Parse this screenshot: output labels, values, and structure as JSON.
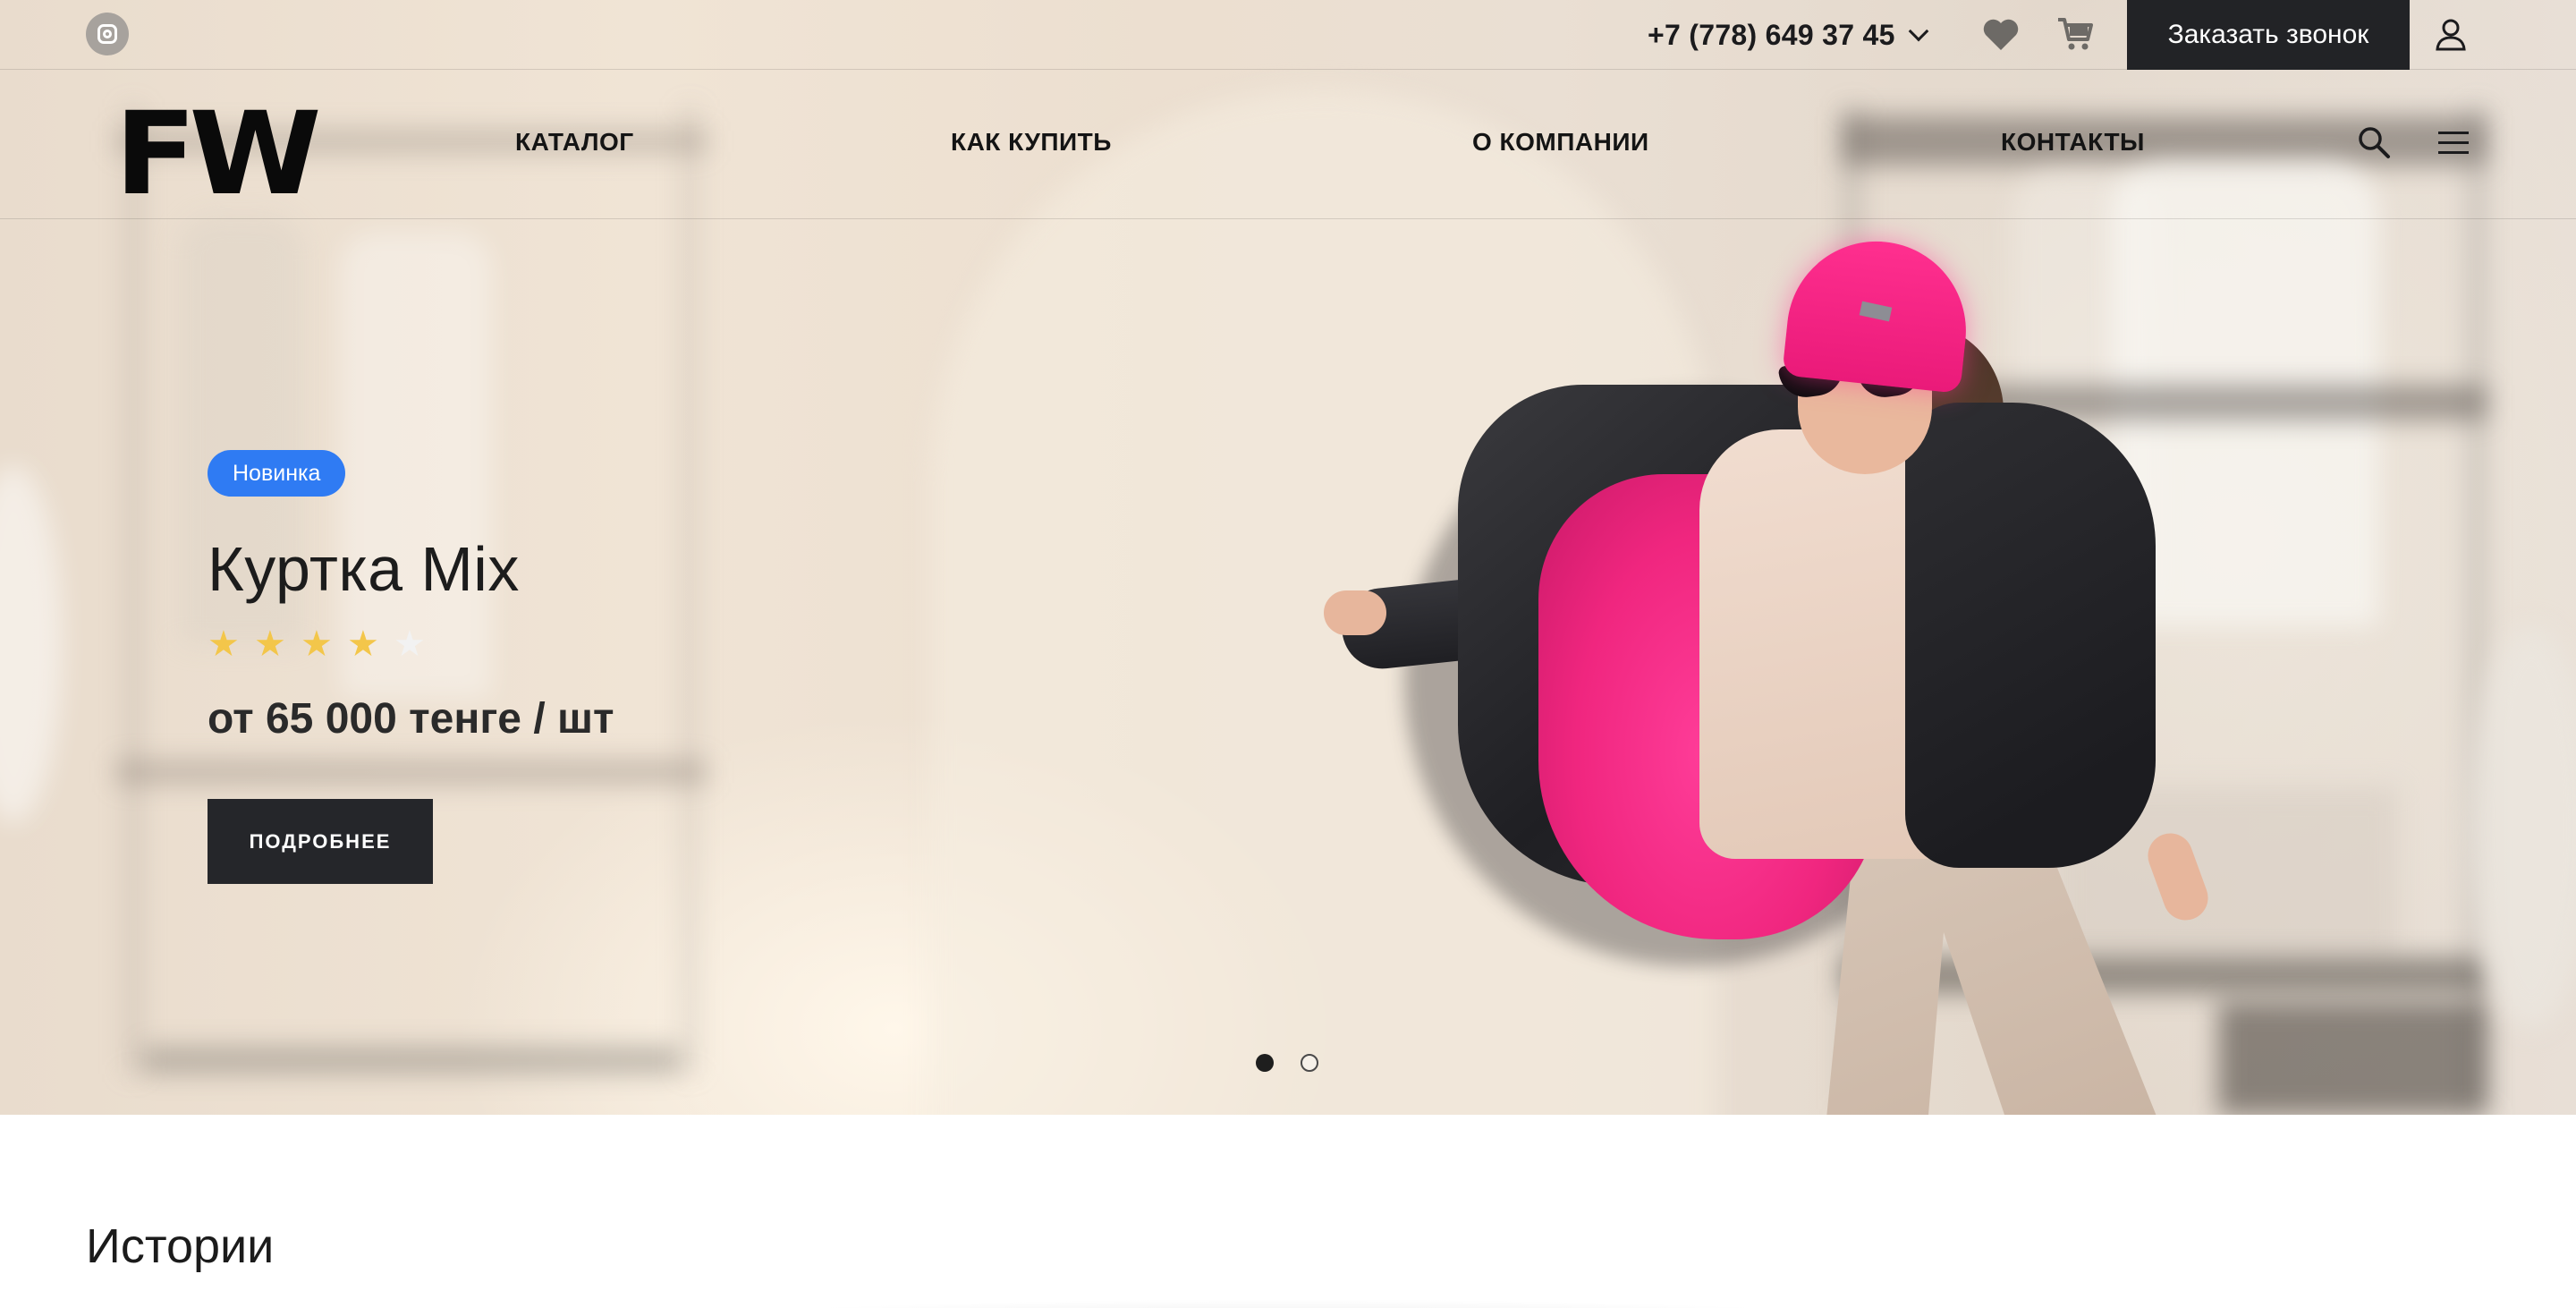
{
  "topbar": {
    "social_icon": "instagram-icon",
    "phone": "+7 (778) 649 37 45",
    "favorites_icon": "heart-icon",
    "cart_icon": "cart-icon",
    "callback_label": "Заказать звонок",
    "account_icon": "user-icon"
  },
  "nav": {
    "logo": "FW",
    "links": [
      {
        "label": "КАТАЛОГ"
      },
      {
        "label": "КАК КУПИТЬ"
      },
      {
        "label": "О КОМПАНИИ"
      },
      {
        "label": "КОНТАКТЫ"
      }
    ],
    "search_icon": "search-icon",
    "menu_icon": "hamburger-menu-icon"
  },
  "hero": {
    "badge": "Новинка",
    "title": "Куртка Mix",
    "rating": 4,
    "rating_max": 5,
    "price": "от 65 000 тенге / шт",
    "button_label": "ПОДРОБНЕЕ",
    "slides_total": 2,
    "active_slide": 1
  },
  "stories": {
    "title": "Истории"
  },
  "colors": {
    "accent_blue": "#2f7bf3",
    "dark_button": "#222326",
    "star": "#f3c64a",
    "beanie_pink": "#ff2f8f"
  }
}
